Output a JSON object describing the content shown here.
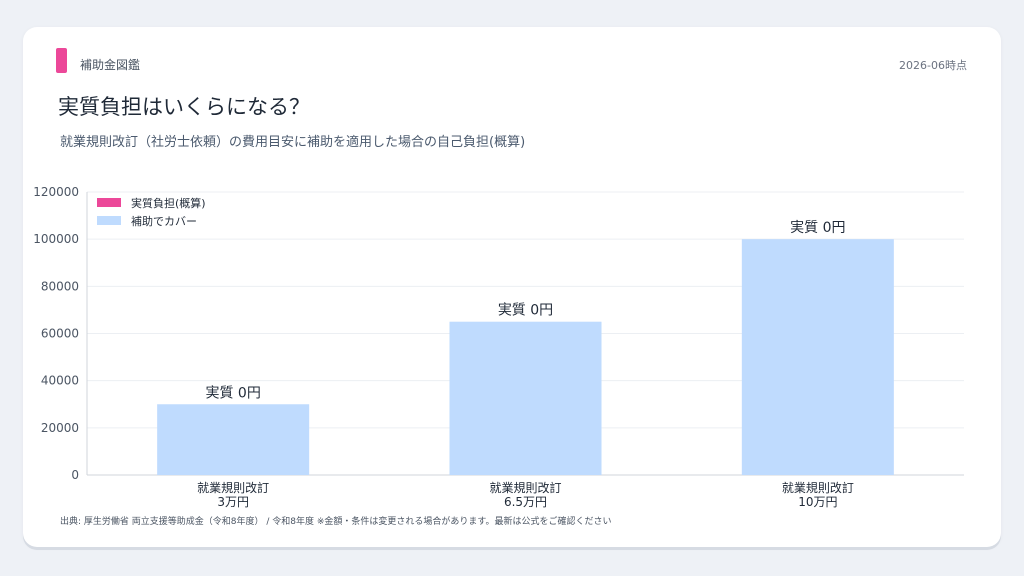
{
  "header": {
    "brand": "補助金図鑑",
    "as_of": "2026-06時点",
    "title": "実質負担はいくらになる？",
    "subtitle": "就業規則改訂（社労士依頼）の費用目安に補助を適用した場合の自己負担(概算)"
  },
  "footer": {
    "source": "出典: 厚生労働省 両立支援等助成金（令和8年度） / 令和8年度 ※金額・条件は変更される場合があります。最新は公式をご確認ください"
  },
  "colors": {
    "accent": "#ec4899",
    "burden": "#ec4899",
    "covered": "#bfdbfe"
  },
  "chart_data": {
    "type": "bar",
    "stacked": true,
    "categories": [
      [
        "就業規則改訂",
        "3万円"
      ],
      [
        "就業規則改訂",
        "6.5万円"
      ],
      [
        "就業規則改訂",
        "10万円"
      ]
    ],
    "series": [
      {
        "name": "実質負担(概算)",
        "values": [
          0,
          0,
          0
        ],
        "color": "#ec4899"
      },
      {
        "name": "補助でカバー",
        "values": [
          30000,
          65000,
          100000
        ],
        "color": "#bfdbfe"
      }
    ],
    "data_labels": [
      "実質 0円",
      "実質 0円",
      "実質 0円"
    ],
    "ylim": [
      0,
      120000
    ],
    "yticks": [
      0,
      20000,
      40000,
      60000,
      80000,
      100000,
      120000
    ],
    "grid": true,
    "legend": "top-left"
  }
}
